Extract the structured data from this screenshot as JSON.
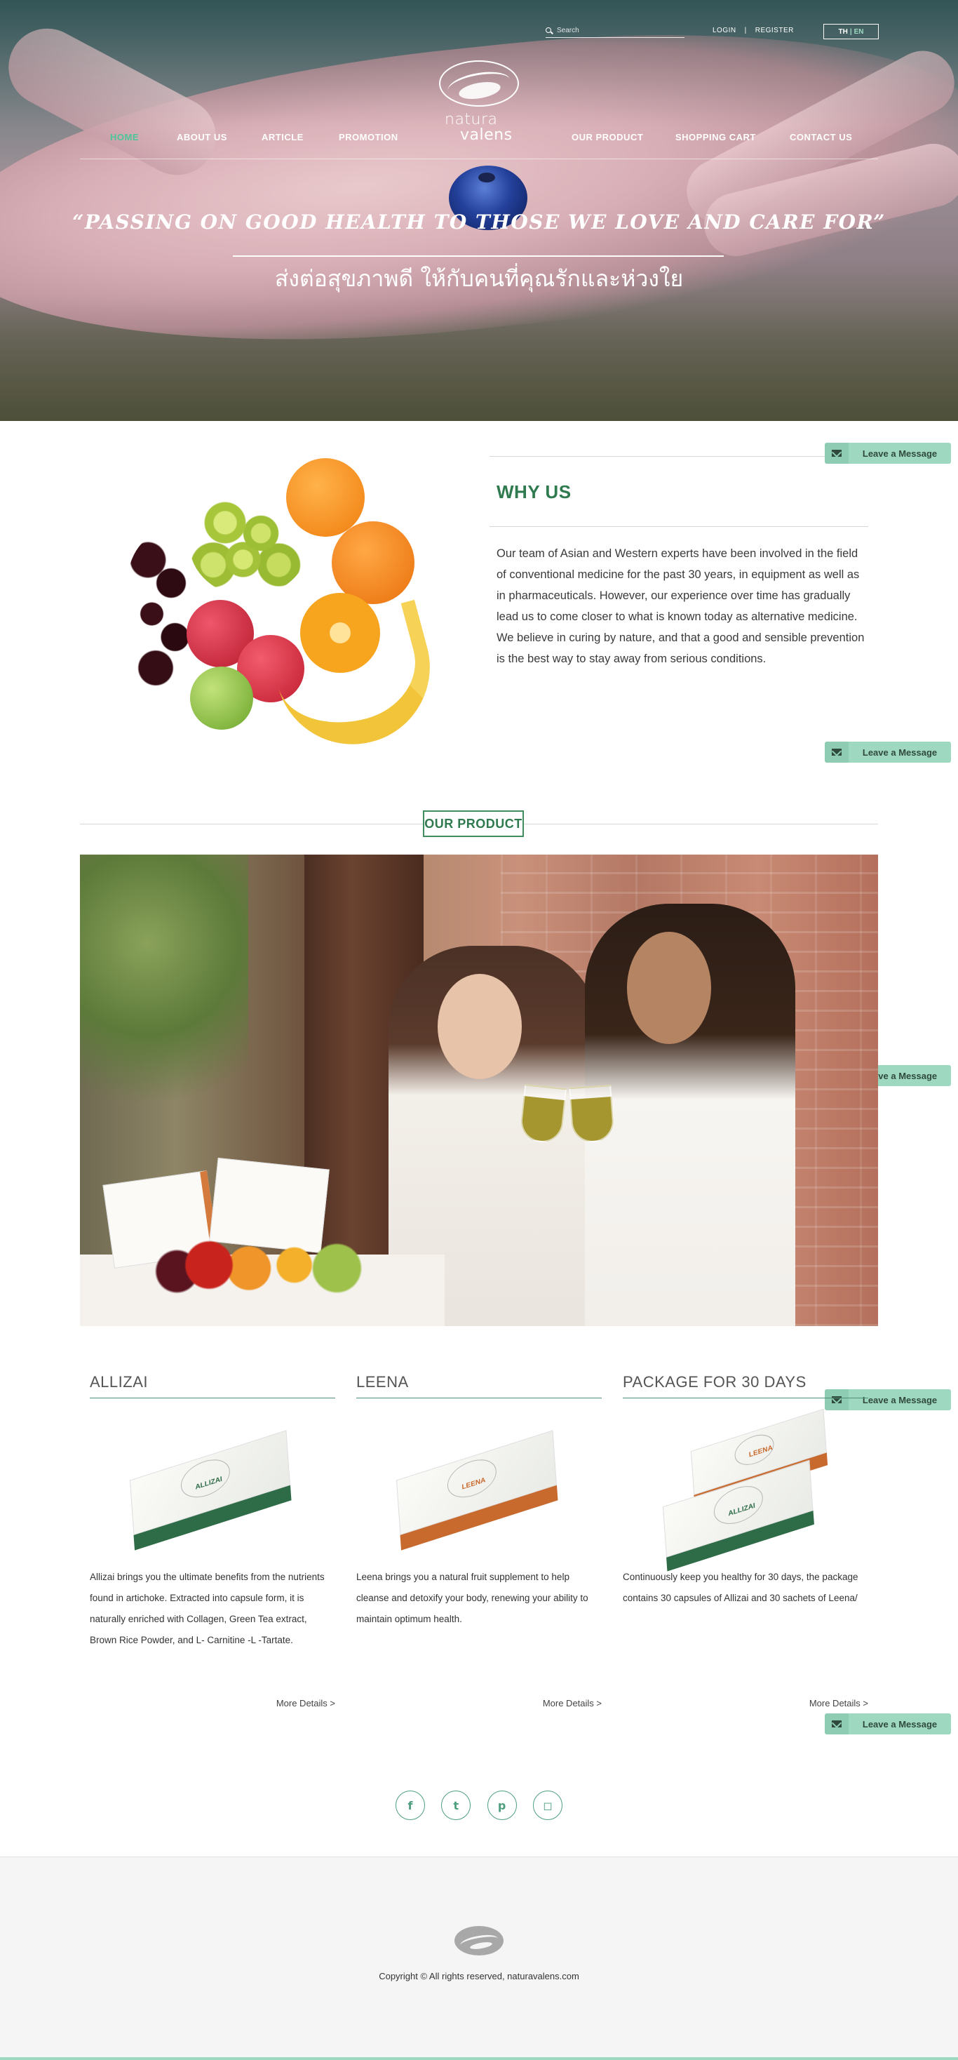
{
  "header": {
    "search_placeholder": "Search",
    "login": "LOGIN",
    "separator": "|",
    "register": "REGISTER",
    "lang_th": "TH",
    "lang_sep": "|",
    "lang_en": "EN",
    "logo_line1": "natura",
    "logo_line2": "valens"
  },
  "nav": {
    "home": "HOME",
    "about": "ABOUT US",
    "article": "ARTICLE",
    "promotion": "PROMOTION",
    "product": "OUR PRODUCT",
    "cart": "SHOPPING CART",
    "contact": "CONTACT US"
  },
  "hero": {
    "quote_en": "“PASSING ON GOOD HEALTH TO THOSE WE LOVE AND CARE FOR”",
    "quote_th": "ส่งต่อสุขภาพดี ให้กับคนที่คุณรักและห่วงใย"
  },
  "why": {
    "title": "WHY US",
    "text": "Our team of Asian and Western experts have been involved in the field of conventional medicine for the past 30 years, in equipment as well as in pharmaceuticals. However, our experience over time has gradually lead us to come closer to what is known today as alternative medicine. We believe in curing by nature, and that a good and sensible prevention is the best way to stay away from serious conditions."
  },
  "message_tab": {
    "label": "Leave a Message"
  },
  "products_section": {
    "title": "OUR PRODUCT"
  },
  "products": [
    {
      "name": "ALLIZAI",
      "box_label": "ALLIZAI",
      "description": "Allizai brings you the ultimate benefits from the nutrients found in artichoke. Extracted into capsule form, it is naturally enriched with Collagen, Green Tea extract, Brown Rice Powder, and L- Carnitine -L -Tartate.",
      "more": "More Details >"
    },
    {
      "name": "LEENA",
      "box_label": "LEENA",
      "description": "Leena brings you a natural fruit supplement to help cleanse and detoxify your body, renewing your ability to maintain optimum health.",
      "more": "More Details >"
    },
    {
      "name": "PACKAGE FOR 30 DAYS",
      "box_label": "ALLIZAI",
      "box_label2": "LEENA",
      "description": "Continuously keep you healthy for 30 days, the package contains 30 capsules of Allizai and 30 sachets of Leena/",
      "more": "More Details >"
    }
  ],
  "social": {
    "facebook": "f",
    "twitter": "t",
    "pinterest": "p",
    "instagram": "◻"
  },
  "footer": {
    "copyright": "Copyright © All rights reserved, naturavalens.com"
  },
  "colors": {
    "accent": "#4cc59a",
    "brand_green": "#2f7a4e",
    "message_tab": "#9fd8c1",
    "leena_orange": "#c8692d",
    "allizai_green": "#2e6b47"
  }
}
